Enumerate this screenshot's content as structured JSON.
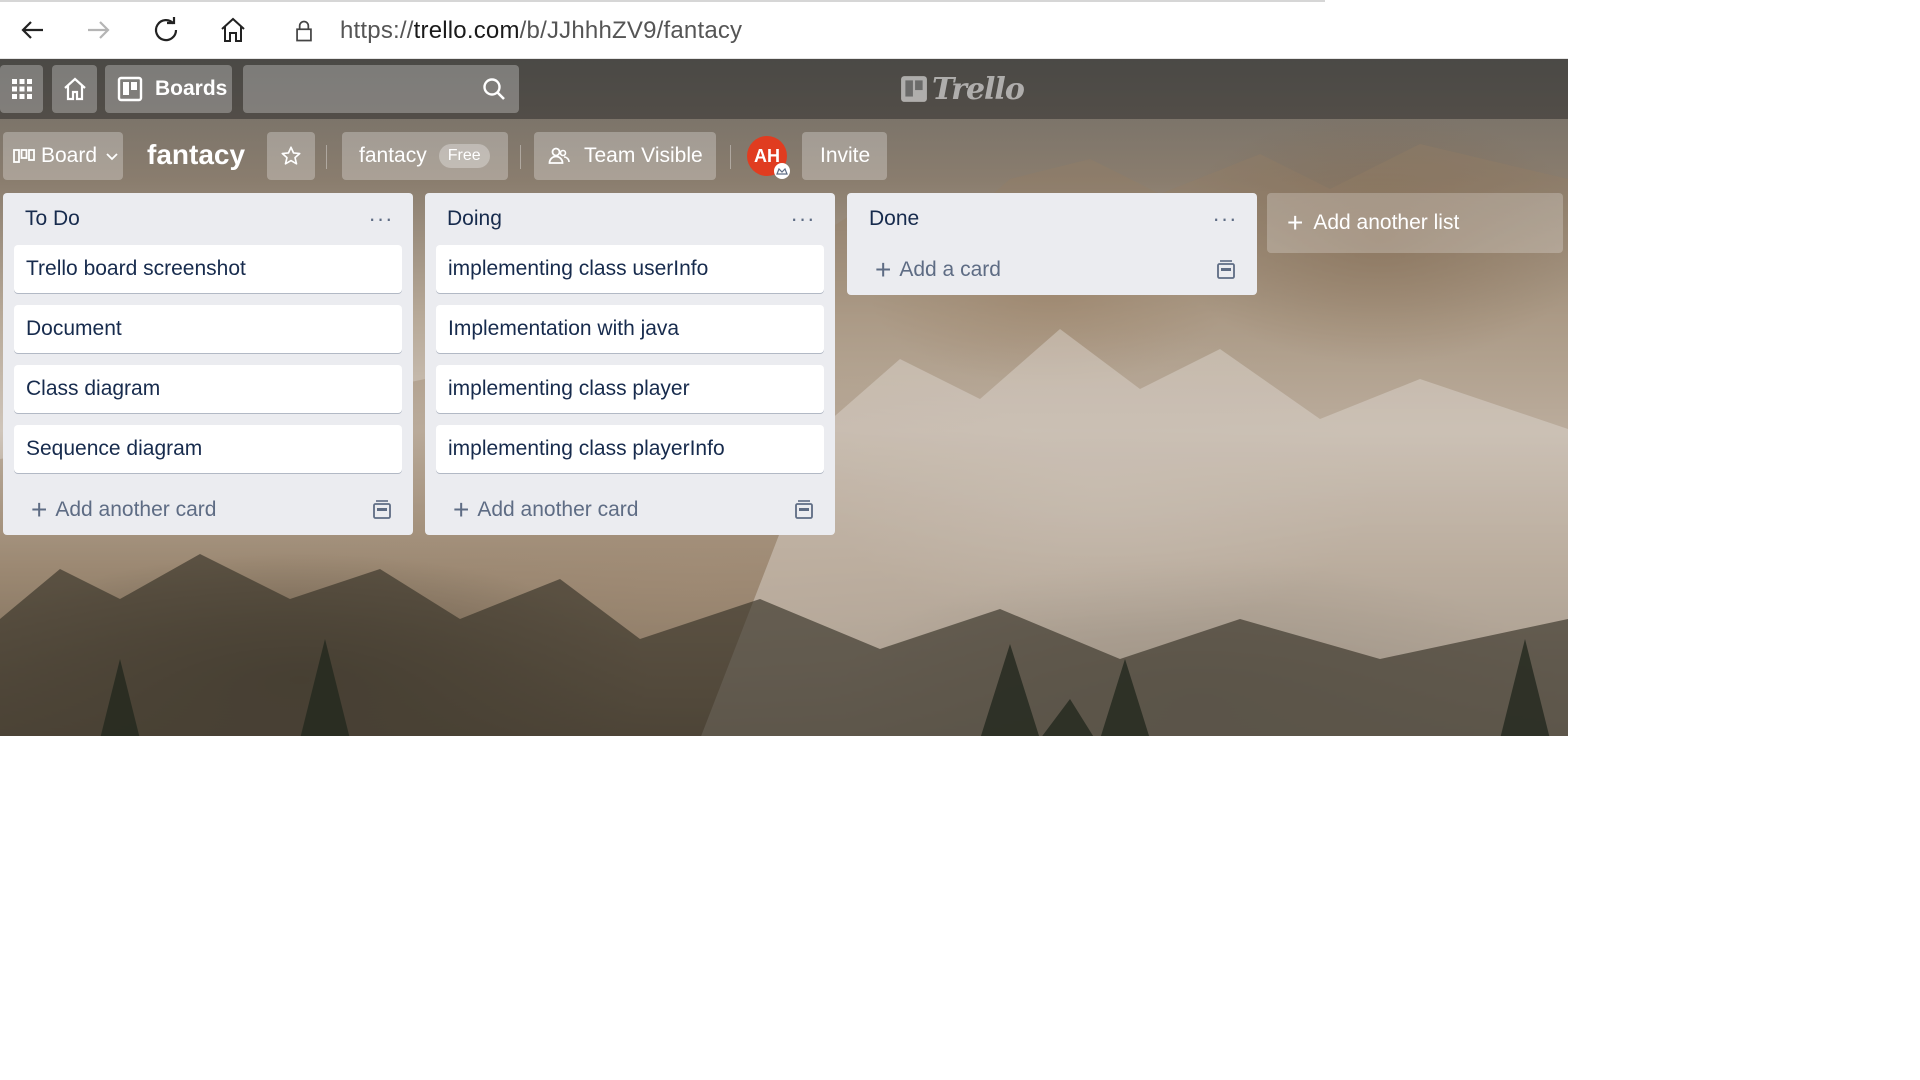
{
  "browser": {
    "url_prefix": "https://",
    "url_host": "trello.com",
    "url_path": "/b/JJhhhZV9/fantacy"
  },
  "header": {
    "boards_label": "Boards",
    "logo_text": "Trello"
  },
  "board": {
    "switch_label": "Board",
    "title": "fantacy",
    "team_name": "fantacy",
    "plan_badge": "Free",
    "visibility_label": "Team Visible",
    "avatar_initials": "AH",
    "invite_label": "Invite"
  },
  "lists": [
    {
      "title": "To Do",
      "cards": [
        "Trello board screenshot",
        "Document",
        "Class diagram",
        "Sequence diagram"
      ],
      "add_label": "Add another card"
    },
    {
      "title": "Doing",
      "cards": [
        "implementing class userInfo",
        "Implementation with java",
        "implementing class player",
        "implementing class playerInfo"
      ],
      "add_label": "Add another card"
    },
    {
      "title": "Done",
      "cards": [],
      "add_label": "Add a card"
    }
  ],
  "add_list_label": "Add another list",
  "colors": {
    "list_bg": "#ebecf0",
    "card_text": "#172b4d",
    "muted_text": "#5e6c84",
    "avatar_bg": "#e03c20"
  }
}
